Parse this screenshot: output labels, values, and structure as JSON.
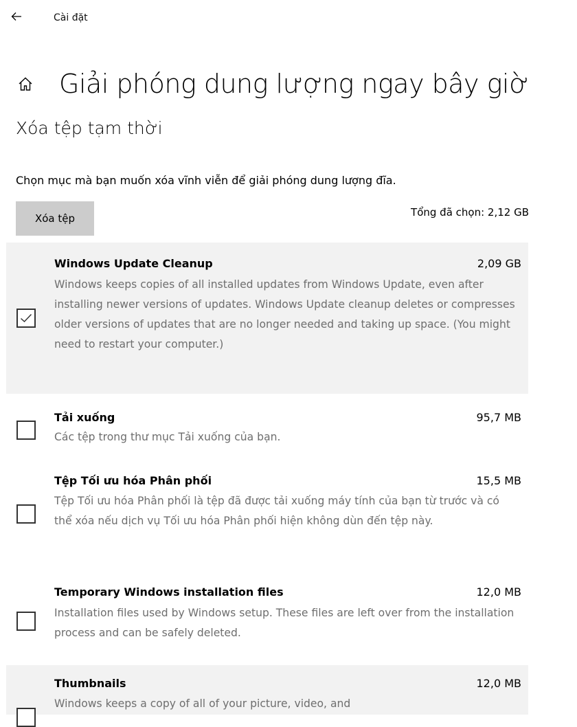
{
  "header": {
    "back_icon": "arrow-left-icon",
    "app_title": "Cài đặt"
  },
  "page": {
    "home_icon": "home-icon",
    "title": "Giải phóng dung lượng ngay bây giờ",
    "section_title": "Xóa tệp tạm thời",
    "instruction": "Chọn mục mà bạn muốn xóa vĩnh viễn để giải phóng dung lượng đĩa.",
    "delete_button_label": "Xóa tệp",
    "total_selected": "Tổng đã chọn: 2,12 GB"
  },
  "items": [
    {
      "name": "Windows Update Cleanup",
      "size": "2,09 GB",
      "checked": true,
      "description": "Windows keeps copies of all installed updates from Windows Update, even after installing newer versions of updates. Windows Update cleanup deletes or compresses older versions of updates that are no longer needed and taking up space. (You might need to restart your computer.)"
    },
    {
      "name": "Tải xuống",
      "size": "95,7 MB",
      "checked": false,
      "description": "Các tệp trong thư mục Tải xuống của bạn."
    },
    {
      "name": "Tệp Tối ưu hóa Phân phối",
      "size": "15,5 MB",
      "checked": false,
      "description": "Tệp Tối ưu hóa Phân phối là tệp đã được tải xuống máy tính của bạn từ trước và có thể xóa nếu dịch vụ Tối ưu hóa Phân phối hiện không dùn đến tệp này."
    },
    {
      "name": "Temporary Windows installation files",
      "size": "12,0 MB",
      "checked": false,
      "description": "Installation files used by Windows setup.  These files are left over from the installation process and can be safely deleted."
    },
    {
      "name": "Thumbnails",
      "size": "12,0 MB",
      "checked": false,
      "description": "Windows keeps a copy of all of your picture, video, and"
    }
  ],
  "colors": {
    "shaded_row": "#f2f2f2",
    "button_bg": "#cccccc",
    "description_text": "#6e6e6e"
  }
}
